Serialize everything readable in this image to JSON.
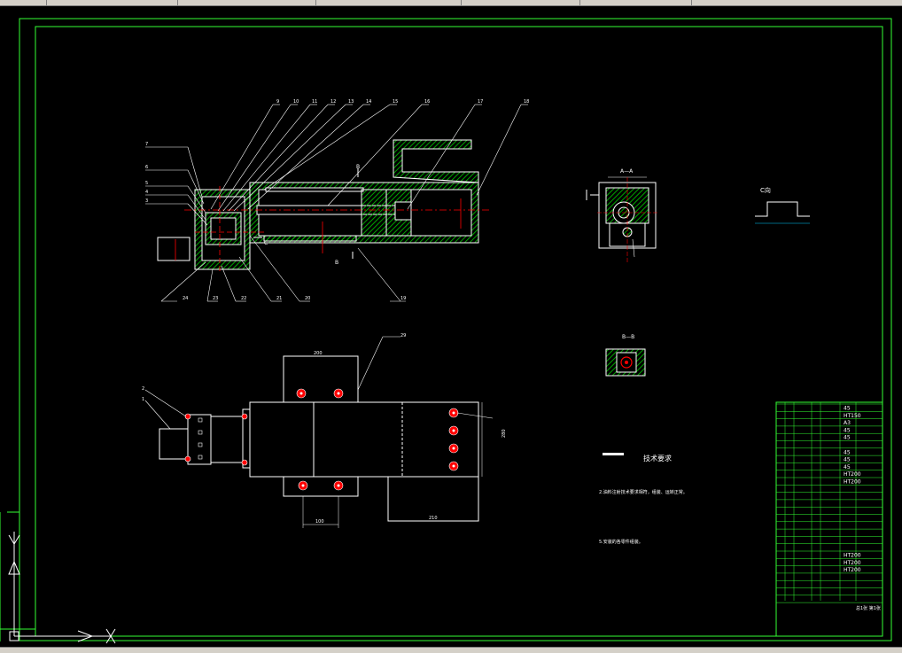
{
  "drawing": {
    "tech_title": "技术要求",
    "tech_notes": [
      "2.油料注射技术要求相符，组装、运转正常。",
      "5.安装的各零件组装。"
    ],
    "section_aa": "A—A",
    "section_bb": "B—B",
    "view_c": "C向",
    "dims": {
      "d200": "200",
      "d100": "100",
      "d210": "210",
      "d280": "280"
    },
    "balloons_top": [
      "9",
      "10",
      "11",
      "12",
      "13",
      "14",
      "15",
      "16",
      "17",
      "18"
    ],
    "balloons_left": [
      "7",
      "6",
      "5",
      "4",
      "3"
    ],
    "balloons_bottom": [
      "24",
      "23",
      "22",
      "21",
      "20",
      "19"
    ],
    "balloon_29": "29",
    "balloons_plan_left": [
      "2",
      "1"
    ],
    "section_marks": [
      "B",
      "B",
      "C"
    ]
  },
  "title_block": {
    "materials": [
      "45",
      "HT150",
      "A3",
      "45",
      "45",
      "45",
      "45",
      "45",
      "HT200",
      "HT200",
      "HT200",
      "HT200",
      "HT200"
    ],
    "summary_label": "总1张 第1张"
  },
  "colors": {
    "frame": "#33ff33",
    "line": "#ffffff",
    "hatch": "#00cc00",
    "red": "#ff0000",
    "background": "#000000"
  },
  "icons": [
    "ucs-y-axis-icon",
    "ucs-x-axis-icon",
    "ucs-origin-icon"
  ]
}
